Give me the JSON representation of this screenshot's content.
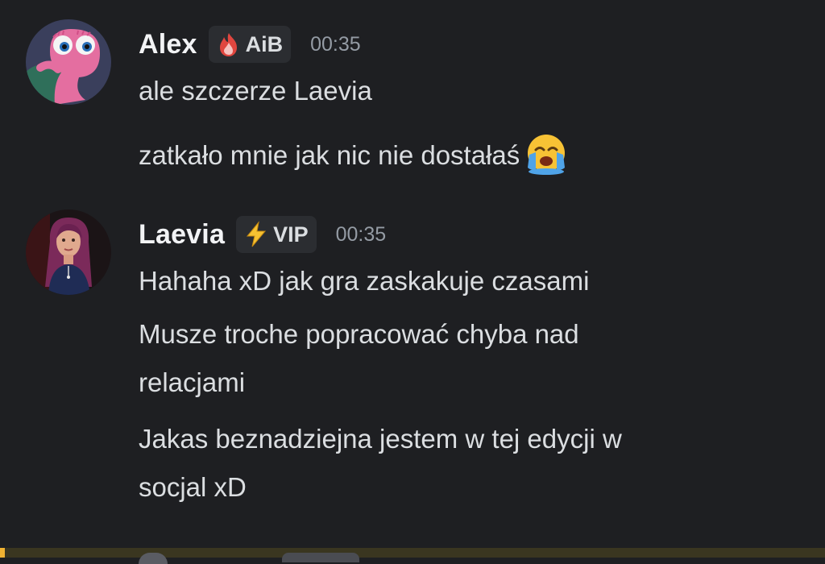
{
  "messages": [
    {
      "author": "Alex",
      "tag": {
        "label": "AiB",
        "icon": "fire-icon"
      },
      "timestamp": "00:35",
      "lines": [
        {
          "text": "ale szczerze Laevia"
        },
        {
          "text": "zatkało mnie jak nic nie dostałaś",
          "emoji": "crying-face-emoji"
        }
      ]
    },
    {
      "author": "Laevia",
      "tag": {
        "label": "VIP",
        "icon": "lightning-icon"
      },
      "timestamp": "00:35",
      "lines": [
        {
          "text": "Hahaha xD jak gra zaskakuje czasami"
        },
        {
          "text": "Musze troche popracować chyba nad"
        },
        {
          "text": "relacjami"
        },
        {
          "text": "Jakas beznadziejna jestem w tej edycji w"
        },
        {
          "text": "socjal xD"
        }
      ]
    }
  ],
  "colors": {
    "background": "#1e1f22",
    "username": "#f2f3f5",
    "message_text": "#dbdee1",
    "timestamp": "#949ba4",
    "tag_background": "#2b2d31",
    "highlight_bar": "#f0b232"
  }
}
